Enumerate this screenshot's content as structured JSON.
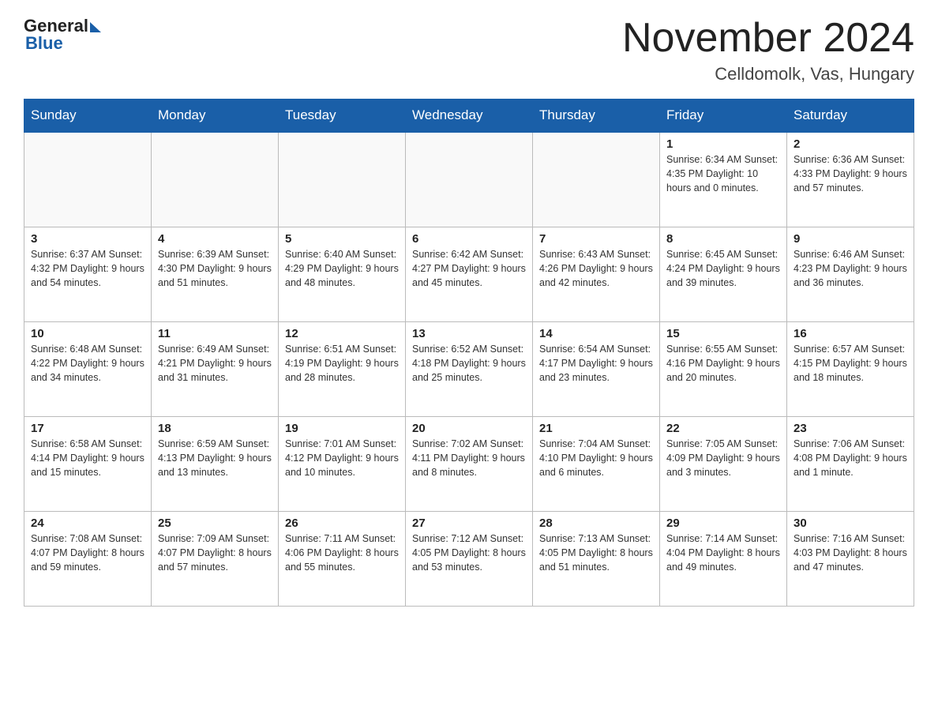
{
  "header": {
    "logo_general": "General",
    "logo_blue": "Blue",
    "month_title": "November 2024",
    "location": "Celldomolk, Vas, Hungary"
  },
  "weekdays": [
    "Sunday",
    "Monday",
    "Tuesday",
    "Wednesday",
    "Thursday",
    "Friday",
    "Saturday"
  ],
  "weeks": [
    [
      {
        "day": "",
        "info": ""
      },
      {
        "day": "",
        "info": ""
      },
      {
        "day": "",
        "info": ""
      },
      {
        "day": "",
        "info": ""
      },
      {
        "day": "",
        "info": ""
      },
      {
        "day": "1",
        "info": "Sunrise: 6:34 AM\nSunset: 4:35 PM\nDaylight: 10 hours and 0 minutes."
      },
      {
        "day": "2",
        "info": "Sunrise: 6:36 AM\nSunset: 4:33 PM\nDaylight: 9 hours and 57 minutes."
      }
    ],
    [
      {
        "day": "3",
        "info": "Sunrise: 6:37 AM\nSunset: 4:32 PM\nDaylight: 9 hours and 54 minutes."
      },
      {
        "day": "4",
        "info": "Sunrise: 6:39 AM\nSunset: 4:30 PM\nDaylight: 9 hours and 51 minutes."
      },
      {
        "day": "5",
        "info": "Sunrise: 6:40 AM\nSunset: 4:29 PM\nDaylight: 9 hours and 48 minutes."
      },
      {
        "day": "6",
        "info": "Sunrise: 6:42 AM\nSunset: 4:27 PM\nDaylight: 9 hours and 45 minutes."
      },
      {
        "day": "7",
        "info": "Sunrise: 6:43 AM\nSunset: 4:26 PM\nDaylight: 9 hours and 42 minutes."
      },
      {
        "day": "8",
        "info": "Sunrise: 6:45 AM\nSunset: 4:24 PM\nDaylight: 9 hours and 39 minutes."
      },
      {
        "day": "9",
        "info": "Sunrise: 6:46 AM\nSunset: 4:23 PM\nDaylight: 9 hours and 36 minutes."
      }
    ],
    [
      {
        "day": "10",
        "info": "Sunrise: 6:48 AM\nSunset: 4:22 PM\nDaylight: 9 hours and 34 minutes."
      },
      {
        "day": "11",
        "info": "Sunrise: 6:49 AM\nSunset: 4:21 PM\nDaylight: 9 hours and 31 minutes."
      },
      {
        "day": "12",
        "info": "Sunrise: 6:51 AM\nSunset: 4:19 PM\nDaylight: 9 hours and 28 minutes."
      },
      {
        "day": "13",
        "info": "Sunrise: 6:52 AM\nSunset: 4:18 PM\nDaylight: 9 hours and 25 minutes."
      },
      {
        "day": "14",
        "info": "Sunrise: 6:54 AM\nSunset: 4:17 PM\nDaylight: 9 hours and 23 minutes."
      },
      {
        "day": "15",
        "info": "Sunrise: 6:55 AM\nSunset: 4:16 PM\nDaylight: 9 hours and 20 minutes."
      },
      {
        "day": "16",
        "info": "Sunrise: 6:57 AM\nSunset: 4:15 PM\nDaylight: 9 hours and 18 minutes."
      }
    ],
    [
      {
        "day": "17",
        "info": "Sunrise: 6:58 AM\nSunset: 4:14 PM\nDaylight: 9 hours and 15 minutes."
      },
      {
        "day": "18",
        "info": "Sunrise: 6:59 AM\nSunset: 4:13 PM\nDaylight: 9 hours and 13 minutes."
      },
      {
        "day": "19",
        "info": "Sunrise: 7:01 AM\nSunset: 4:12 PM\nDaylight: 9 hours and 10 minutes."
      },
      {
        "day": "20",
        "info": "Sunrise: 7:02 AM\nSunset: 4:11 PM\nDaylight: 9 hours and 8 minutes."
      },
      {
        "day": "21",
        "info": "Sunrise: 7:04 AM\nSunset: 4:10 PM\nDaylight: 9 hours and 6 minutes."
      },
      {
        "day": "22",
        "info": "Sunrise: 7:05 AM\nSunset: 4:09 PM\nDaylight: 9 hours and 3 minutes."
      },
      {
        "day": "23",
        "info": "Sunrise: 7:06 AM\nSunset: 4:08 PM\nDaylight: 9 hours and 1 minute."
      }
    ],
    [
      {
        "day": "24",
        "info": "Sunrise: 7:08 AM\nSunset: 4:07 PM\nDaylight: 8 hours and 59 minutes."
      },
      {
        "day": "25",
        "info": "Sunrise: 7:09 AM\nSunset: 4:07 PM\nDaylight: 8 hours and 57 minutes."
      },
      {
        "day": "26",
        "info": "Sunrise: 7:11 AM\nSunset: 4:06 PM\nDaylight: 8 hours and 55 minutes."
      },
      {
        "day": "27",
        "info": "Sunrise: 7:12 AM\nSunset: 4:05 PM\nDaylight: 8 hours and 53 minutes."
      },
      {
        "day": "28",
        "info": "Sunrise: 7:13 AM\nSunset: 4:05 PM\nDaylight: 8 hours and 51 minutes."
      },
      {
        "day": "29",
        "info": "Sunrise: 7:14 AM\nSunset: 4:04 PM\nDaylight: 8 hours and 49 minutes."
      },
      {
        "day": "30",
        "info": "Sunrise: 7:16 AM\nSunset: 4:03 PM\nDaylight: 8 hours and 47 minutes."
      }
    ]
  ]
}
